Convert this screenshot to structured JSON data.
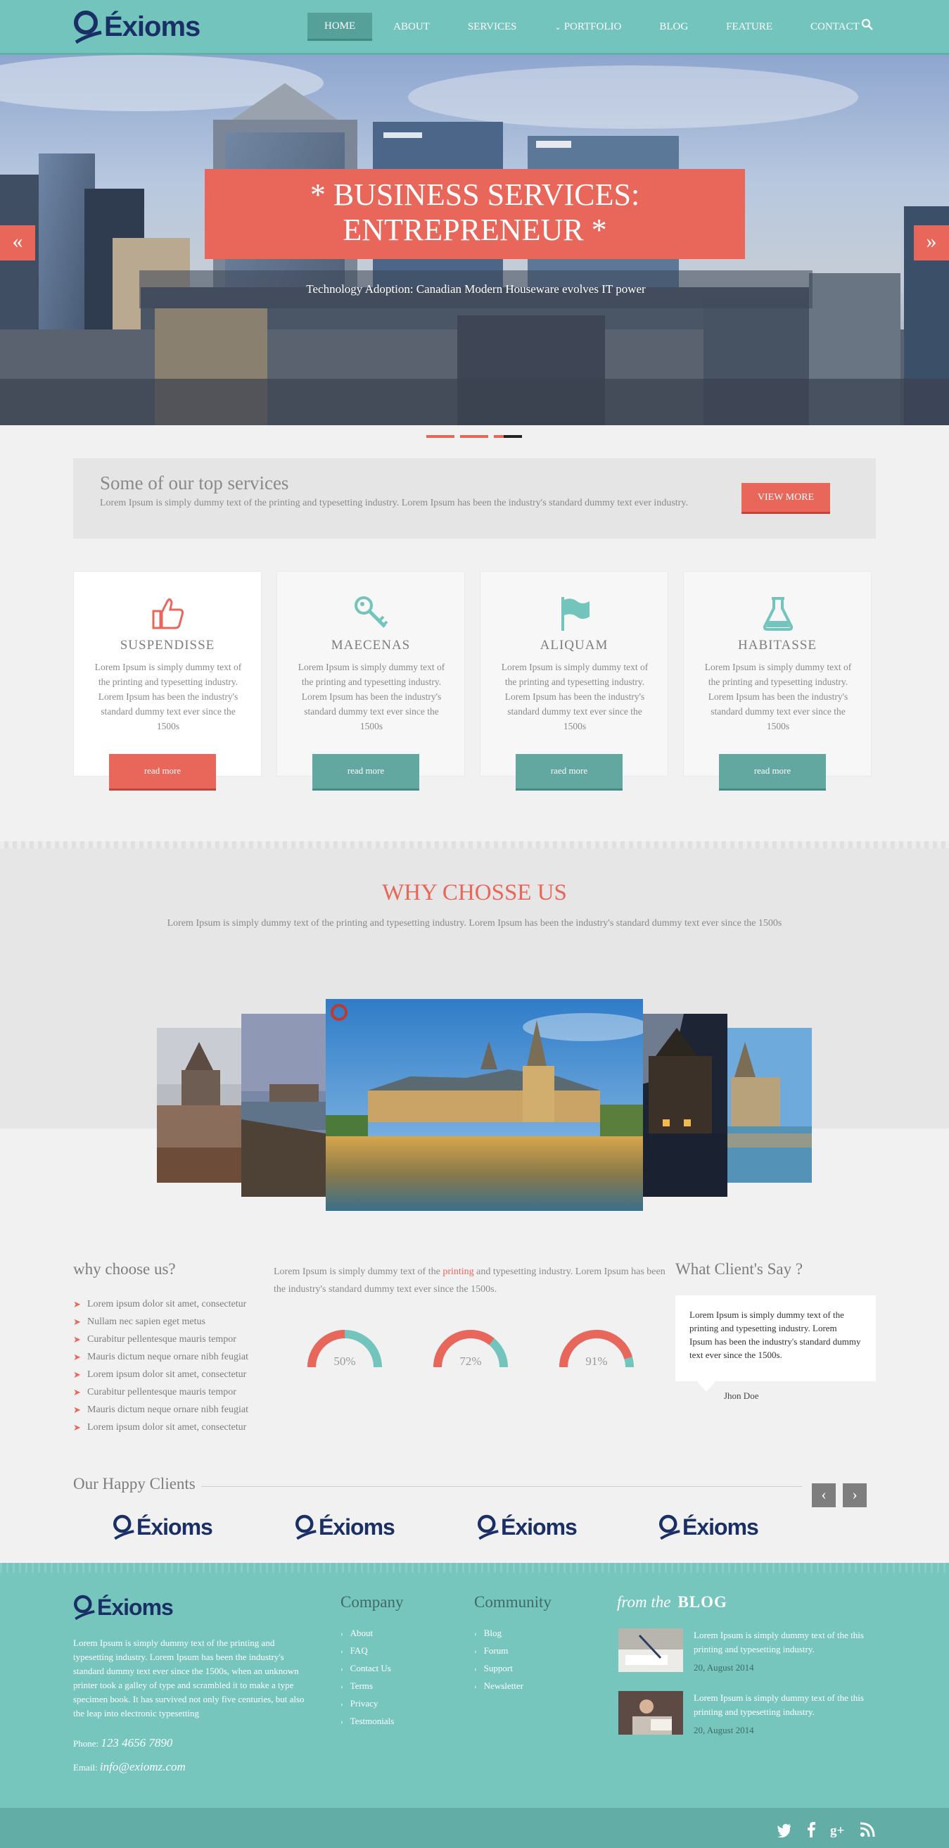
{
  "brand": {
    "name": "Éxioms"
  },
  "nav": {
    "items": [
      {
        "label": "HOME",
        "active": true
      },
      {
        "label": "ABOUT"
      },
      {
        "label": "SERVICES"
      },
      {
        "label": "PORTFOLIO",
        "has_caret": true
      },
      {
        "label": "BLOG"
      },
      {
        "label": "FEATURE"
      },
      {
        "label": "CONTACT"
      }
    ],
    "search_icon": "search-icon"
  },
  "hero": {
    "title_line1": "* BUSINESS SERVICES:",
    "title_line2": "ENTREPRENEUR *",
    "subtitle": "Technology Adoption: Canadian Modern Houseware evolves IT power",
    "prev_icon": "double-chevron-left-icon",
    "next_icon": "double-chevron-right-icon",
    "slides": 3,
    "active_slide": 3
  },
  "services_bar": {
    "heading": "Some of our top services",
    "text": "Lorem Ipsum is simply dummy text of the printing and typesetting industry. Lorem Ipsum has been the industry's standard dummy text ever industry.",
    "button": "VIEW MORE"
  },
  "cards": [
    {
      "title": "SUSPENDISSE",
      "icon": "thumbs-up-icon",
      "text": "Lorem Ipsum is simply dummy text of the printing and typesetting industry. Lorem Ipsum has been the industry's standard dummy text ever since the 1500s",
      "button": "read more"
    },
    {
      "title": "MAECENAS",
      "icon": "key-icon",
      "text": "Lorem Ipsum is simply dummy text of the printing and typesetting industry. Lorem Ipsum has been the industry's standard dummy text ever since the 1500s",
      "button": "read more"
    },
    {
      "title": "ALIQUAM",
      "icon": "flag-icon",
      "text": "Lorem Ipsum is simply dummy text of the printing and typesetting industry. Lorem Ipsum has been the industry's standard dummy text ever since the 1500s",
      "button": "raed more"
    },
    {
      "title": "HABITASSE",
      "icon": "flask-icon",
      "text": "Lorem Ipsum is simply dummy text of the printing and typesetting industry. Lorem Ipsum has been the industry's standard dummy text ever since the 1500s",
      "button": "read more"
    }
  ],
  "why": {
    "title": "WHY CHOSSE US",
    "text": "Lorem Ipsum is simply dummy text of the printing and typesetting industry. Lorem Ipsum has been the industry's standard dummy text ever since the 1500s"
  },
  "why_list": {
    "heading": "why choose us?",
    "items": [
      "Lorem ipsum dolor sit amet, consectetur",
      "Nullam nec sapien eget metus",
      "Curabitur pellentesque mauris tempor",
      "Mauris dictum neque ornare nibh feugiat",
      "Lorem ipsum dolor sit amet, consectetur",
      "Curabitur pellentesque mauris tempor",
      "Mauris dictum neque ornare nibh feugiat",
      "Lorem ipsum dolor sit amet, consectetur"
    ]
  },
  "middle": {
    "text_before": "Lorem Ipsum is simply dummy text of the ",
    "highlight": "printing",
    "text_after": " and typesetting industry. Lorem Ipsum has been the industry's standard dummy text ever since the 1500s.",
    "gauges": [
      {
        "label": "50%",
        "value": 50
      },
      {
        "label": "72%",
        "value": 72
      },
      {
        "label": "91%",
        "value": 91
      }
    ]
  },
  "testimonial": {
    "heading": "What Client's Say ?",
    "quote": "Lorem Ipsum is simply dummy text of the printing and typesetting industry. Lorem Ipsum has been the industry's standard dummy text ever since the 1500s.",
    "author": "Jhon Doe"
  },
  "clients": {
    "heading": "Our Happy Clients",
    "prev_icon": "chevron-left-icon",
    "next_icon": "chevron-right-icon",
    "logos": [
      "Éxioms",
      "Éxioms",
      "Éxioms",
      "Éxioms"
    ]
  },
  "footer": {
    "about": "Lorem Ipsum is simply dummy text of the printing and typesetting industry. Lorem Ipsum has been the industry's standard dummy text ever since the 1500s, when an unknown printer took a galley of type and scrambled it to make a type specimen book. It has survived not only five centuries, but also the leap into electronic typesetting",
    "phone_label": "Phone:",
    "phone": "123 4656 7890",
    "email_label": "Email:",
    "email": "info@exiomz.com",
    "company": {
      "heading": "Company",
      "links": [
        "About",
        "FAQ",
        "Contact Us",
        "Terms",
        "Privacy",
        "Testmonials"
      ]
    },
    "community": {
      "heading": "Community",
      "links": [
        "Blog",
        "Forum",
        "Support",
        "Newsletter"
      ]
    },
    "blog": {
      "heading_from": "from the",
      "heading_blog": "BLOG",
      "posts": [
        {
          "text": "Lorem Ipsum is simply dummy text of the this printing and typesetting industry.",
          "date": "20, August 2014"
        },
        {
          "text": "Lorem Ipsum is simply dummy text of the this printing and typesetting industry.",
          "date": "20, August 2014"
        }
      ]
    },
    "social": [
      "twitter-icon",
      "facebook-icon",
      "google-plus-icon",
      "rss-icon"
    ]
  },
  "colors": {
    "accent": "#e8675a",
    "teal": "#73c4bc",
    "dark_teal": "#62a8a0",
    "navy": "#1a2f66"
  }
}
